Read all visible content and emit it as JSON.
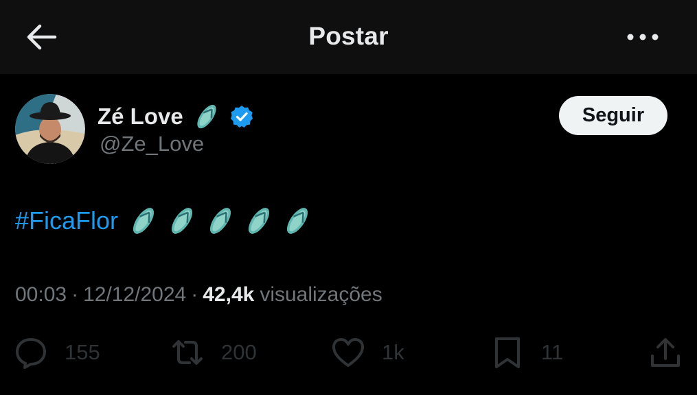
{
  "header": {
    "title": "Postar",
    "back_icon": "arrow-left-icon",
    "more_icon": "more-horizontal-icon"
  },
  "author": {
    "display_name": "Zé Love",
    "handle": "@Ze_Love",
    "name_emoji": "flip-flop-emoji",
    "verified_icon": "verified-badge-icon",
    "verified_color": "#1d9bf0"
  },
  "follow_button": {
    "label": "Seguir"
  },
  "post": {
    "hashtag": "#FicaFlor",
    "emoji": "flip-flop-emoji",
    "emoji_count": 5,
    "hashtag_color": "#1d9bf0"
  },
  "meta": {
    "time": "00:03",
    "separator": "·",
    "date": "12/12/2024",
    "views_count": "42,4k",
    "views_label": "visualizações"
  },
  "actions": {
    "reply": {
      "icon": "reply-icon",
      "count": "155"
    },
    "repost": {
      "icon": "repost-icon",
      "count": "200"
    },
    "like": {
      "icon": "heart-icon",
      "count": "1k"
    },
    "bookmark": {
      "icon": "bookmark-icon",
      "count": "11"
    },
    "share": {
      "icon": "share-icon"
    }
  },
  "colors": {
    "background": "#000000",
    "header_background": "#0f0f0f",
    "primary_text": "#e7e9ea",
    "secondary_text": "#71767b",
    "faded_action": "#2f3336"
  }
}
